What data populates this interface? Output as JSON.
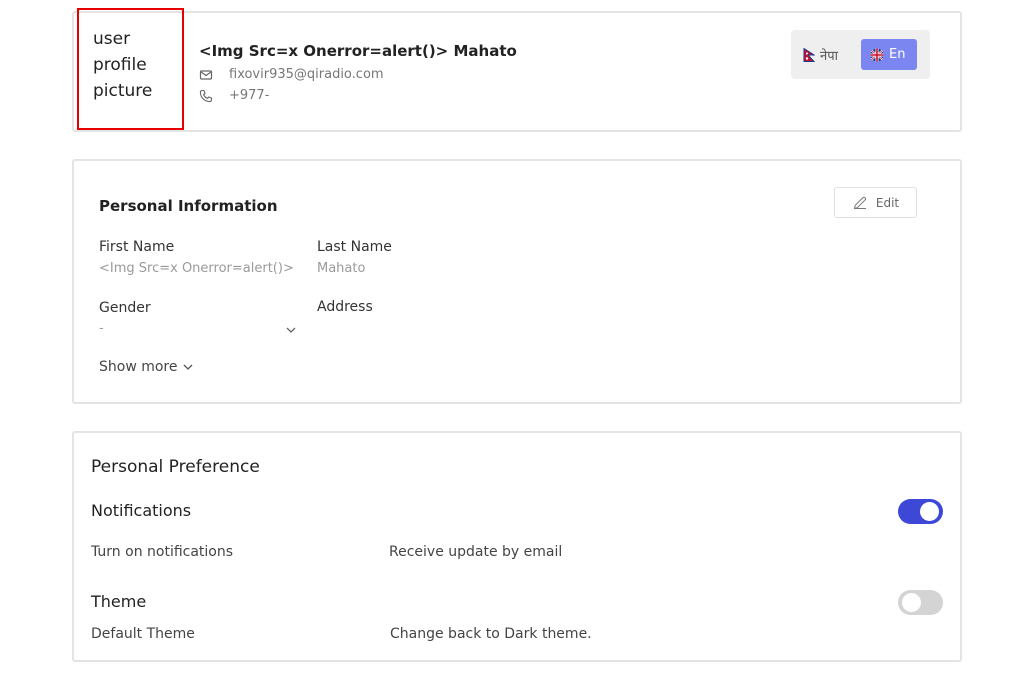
{
  "profile": {
    "avatar_alt_text": "user profile picture",
    "name": "<Img Src=x Onerror=alert()> Mahato",
    "email": "fixovir935@qiradio.com",
    "phone": "+977-",
    "icons": {
      "email": "mail-icon",
      "phone": "phone-icon"
    }
  },
  "language_switch": {
    "options": [
      {
        "label": "नेपा",
        "flag": "nepal-flag-icon",
        "selected": false
      },
      {
        "label": "En",
        "flag": "uk-flag-icon",
        "selected": true
      }
    ],
    "accent": "#7b86f0"
  },
  "personal_info": {
    "title": "Personal Information",
    "edit_label": "Edit",
    "fields": {
      "first_name": {
        "label": "First Name",
        "value": "<Img Src=x Onerror=alert()>"
      },
      "last_name": {
        "label": "Last Name",
        "value": "Mahato"
      },
      "gender": {
        "label": "Gender",
        "value": "-"
      },
      "address": {
        "label": "Address",
        "value": ""
      }
    },
    "show_more_label": "Show more"
  },
  "preferences": {
    "title": "Personal Preference",
    "notifications": {
      "label": "Notifications",
      "description": "Turn on notifications",
      "detail": "Receive update by email",
      "enabled": true
    },
    "theme": {
      "label": "Theme",
      "description": "Default Theme",
      "detail": "Change back to Dark theme.",
      "enabled": false
    },
    "toggle_on_color": "#3d49d6",
    "toggle_off_color": "#d4d4d4"
  }
}
